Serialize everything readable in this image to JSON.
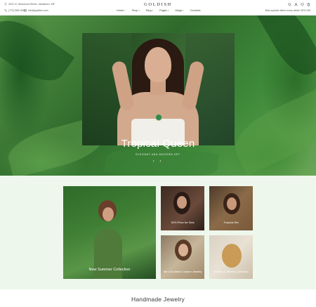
{
  "header": {
    "address": "2021 N. Glenwood Street, Jacksboro, MF",
    "phone": "(772) 555-9054",
    "email": "info@goldish.com",
    "logo": "GOLDISH",
    "nav": [
      {
        "label": "Home"
      },
      {
        "label": "Shop"
      },
      {
        "label": "Blog"
      },
      {
        "label": "Pages"
      },
      {
        "label": "Mega"
      },
      {
        "label": "Contacts"
      }
    ],
    "promo": "Best special offers every week!  40% Off!",
    "icons": [
      "search-icon",
      "user-icon",
      "heart-icon",
      "cart-icon"
    ]
  },
  "hero": {
    "title": "Tropical Queen",
    "subtitle": "ELEGANT AND MODERN SET",
    "prev": "‹",
    "next": "›"
  },
  "collections": {
    "tiles": [
      {
        "label": "New Summer Collection"
      },
      {
        "label": "30% Price for Sets"
      },
      {
        "label": "Tropical Set"
      },
      {
        "label": "We Can Make Custom Jewelry"
      },
      {
        "label": "Jewelry & Stones Collection"
      }
    ]
  },
  "section": {
    "title": "Handmade Jewelry"
  }
}
